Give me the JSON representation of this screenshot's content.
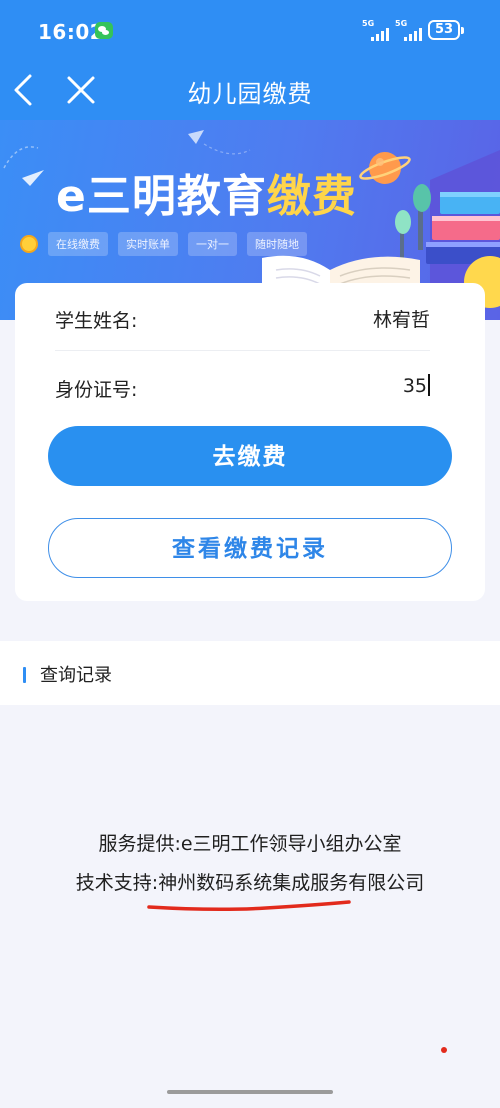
{
  "status_bar": {
    "time": "16:02",
    "app_icon": "wechat-icon",
    "signal_1": "5G",
    "signal_2": "5G",
    "battery": "53"
  },
  "nav": {
    "title": "幼儿园缴费",
    "back_icon": "chevron-left-icon",
    "close_icon": "close-icon"
  },
  "banner": {
    "title_prefix": "e三明教育",
    "title_accent": "缴费",
    "tags": [
      "在线缴费",
      "实时账单",
      "一对一",
      "随时随地"
    ]
  },
  "form": {
    "name_label": "学生姓名:",
    "name_value": "林宥哲",
    "id_label": "身份证号:",
    "id_value": "35"
  },
  "buttons": {
    "pay": "去缴费",
    "records": "查看缴费记录"
  },
  "query": {
    "title": "查询记录"
  },
  "footer": {
    "service": "服务提供:e三明工作领导小组办公室",
    "support": "技术支持:神州数码系统集成服务有限公司"
  },
  "colors": {
    "primary": "#2f8ef4",
    "button": "#2990f0",
    "accent_yellow": "#ffd54a",
    "annotation_red": "#e22a1c"
  }
}
